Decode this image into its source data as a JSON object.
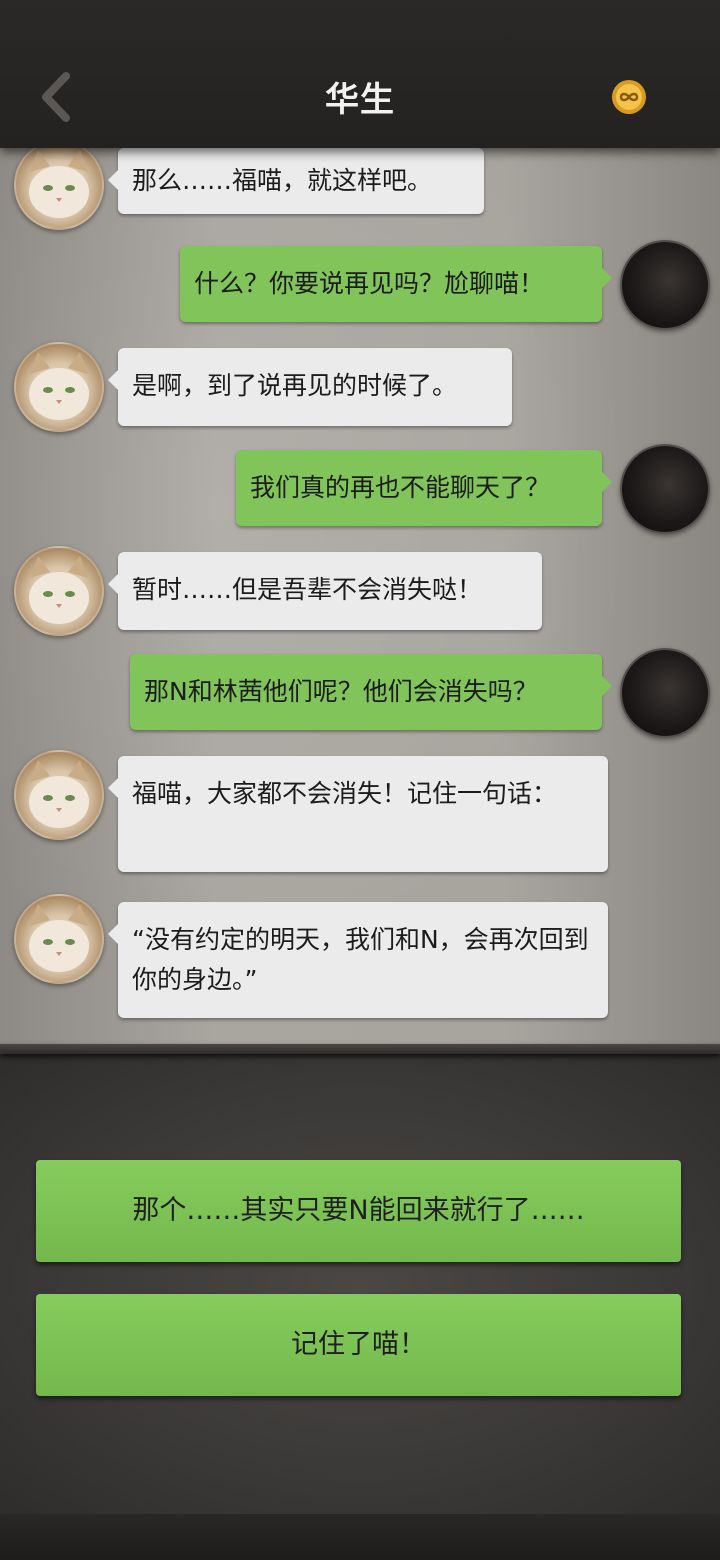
{
  "header": {
    "title": "华生",
    "back_icon": "chevron-left-icon",
    "badge_icon": "infinity-coin-icon",
    "badge_color": "#e0a52b"
  },
  "messages": [
    {
      "side": "left",
      "avatar": "cat-avatar",
      "text": "那么……福喵，就这样吧。"
    },
    {
      "side": "right",
      "avatar": "dark-avatar",
      "text": "什么？你要说再见吗？尬聊喵！"
    },
    {
      "side": "left",
      "avatar": "cat-avatar",
      "text": "是啊，到了说再见的时候了。"
    },
    {
      "side": "right",
      "avatar": "dark-avatar",
      "text": "我们真的再也不能聊天了？"
    },
    {
      "side": "left",
      "avatar": "cat-avatar",
      "text": "暂时……但是吾辈不会消失哒！"
    },
    {
      "side": "right",
      "avatar": "dark-avatar",
      "text": "那N和林茜他们呢？他们会消失吗？"
    },
    {
      "side": "left",
      "avatar": "cat-avatar",
      "text": "福喵，大家都不会消失！记住一句话："
    },
    {
      "side": "left",
      "avatar": "cat-avatar",
      "text": "“没有约定的明天，我们和N，会再次回到你的身边。”"
    }
  ],
  "choices": [
    {
      "label": "那个……其实只要N能回来就行了……"
    },
    {
      "label": "记住了喵！"
    }
  ],
  "colors": {
    "bubble_left": "#ebebeb",
    "bubble_right": "#80c45a",
    "choice_button": "#7ec154"
  }
}
